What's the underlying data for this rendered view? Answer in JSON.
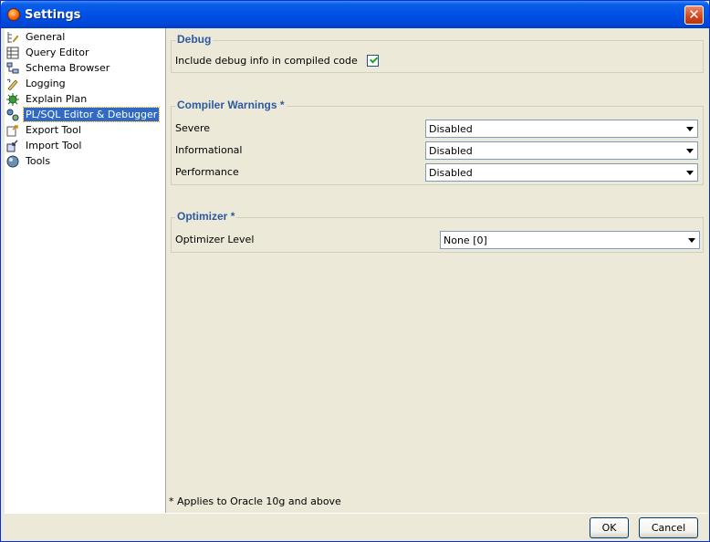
{
  "window": {
    "title": "Settings",
    "close_glyph": "✕"
  },
  "tree": {
    "items": [
      {
        "label": "General",
        "icon": "general-icon"
      },
      {
        "label": "Query Editor",
        "icon": "query-editor-icon"
      },
      {
        "label": "Schema Browser",
        "icon": "schema-browser-icon"
      },
      {
        "label": "Logging",
        "icon": "logging-icon"
      },
      {
        "label": "Explain Plan",
        "icon": "explain-plan-icon"
      },
      {
        "label": "PL/SQL Editor & Debugger",
        "icon": "plsql-debugger-icon",
        "selected": true
      },
      {
        "label": "Export Tool",
        "icon": "export-tool-icon"
      },
      {
        "label": "Import Tool",
        "icon": "import-tool-icon"
      },
      {
        "label": "Tools",
        "icon": "tools-icon"
      }
    ]
  },
  "debug": {
    "legend": "Debug",
    "include_label": "Include debug info in compiled code",
    "include_checked": true
  },
  "compiler_warnings": {
    "legend": "Compiler Warnings",
    "asterisk": "*",
    "severe_label": "Severe",
    "severe_value": "Disabled",
    "informational_label": "Informational",
    "informational_value": "Disabled",
    "performance_label": "Performance",
    "performance_value": "Disabled"
  },
  "optimizer": {
    "legend": "Optimizer",
    "asterisk": "*",
    "level_label": "Optimizer Level",
    "level_value": "None [0]"
  },
  "footnote": "* Applies to Oracle 10g and above",
  "buttons": {
    "ok": "OK",
    "cancel": "Cancel"
  },
  "colors": {
    "title_bar": "#0050e6",
    "legend_text": "#2c5aa0",
    "selection": "#316ac5",
    "checkmark": "#21a121"
  }
}
